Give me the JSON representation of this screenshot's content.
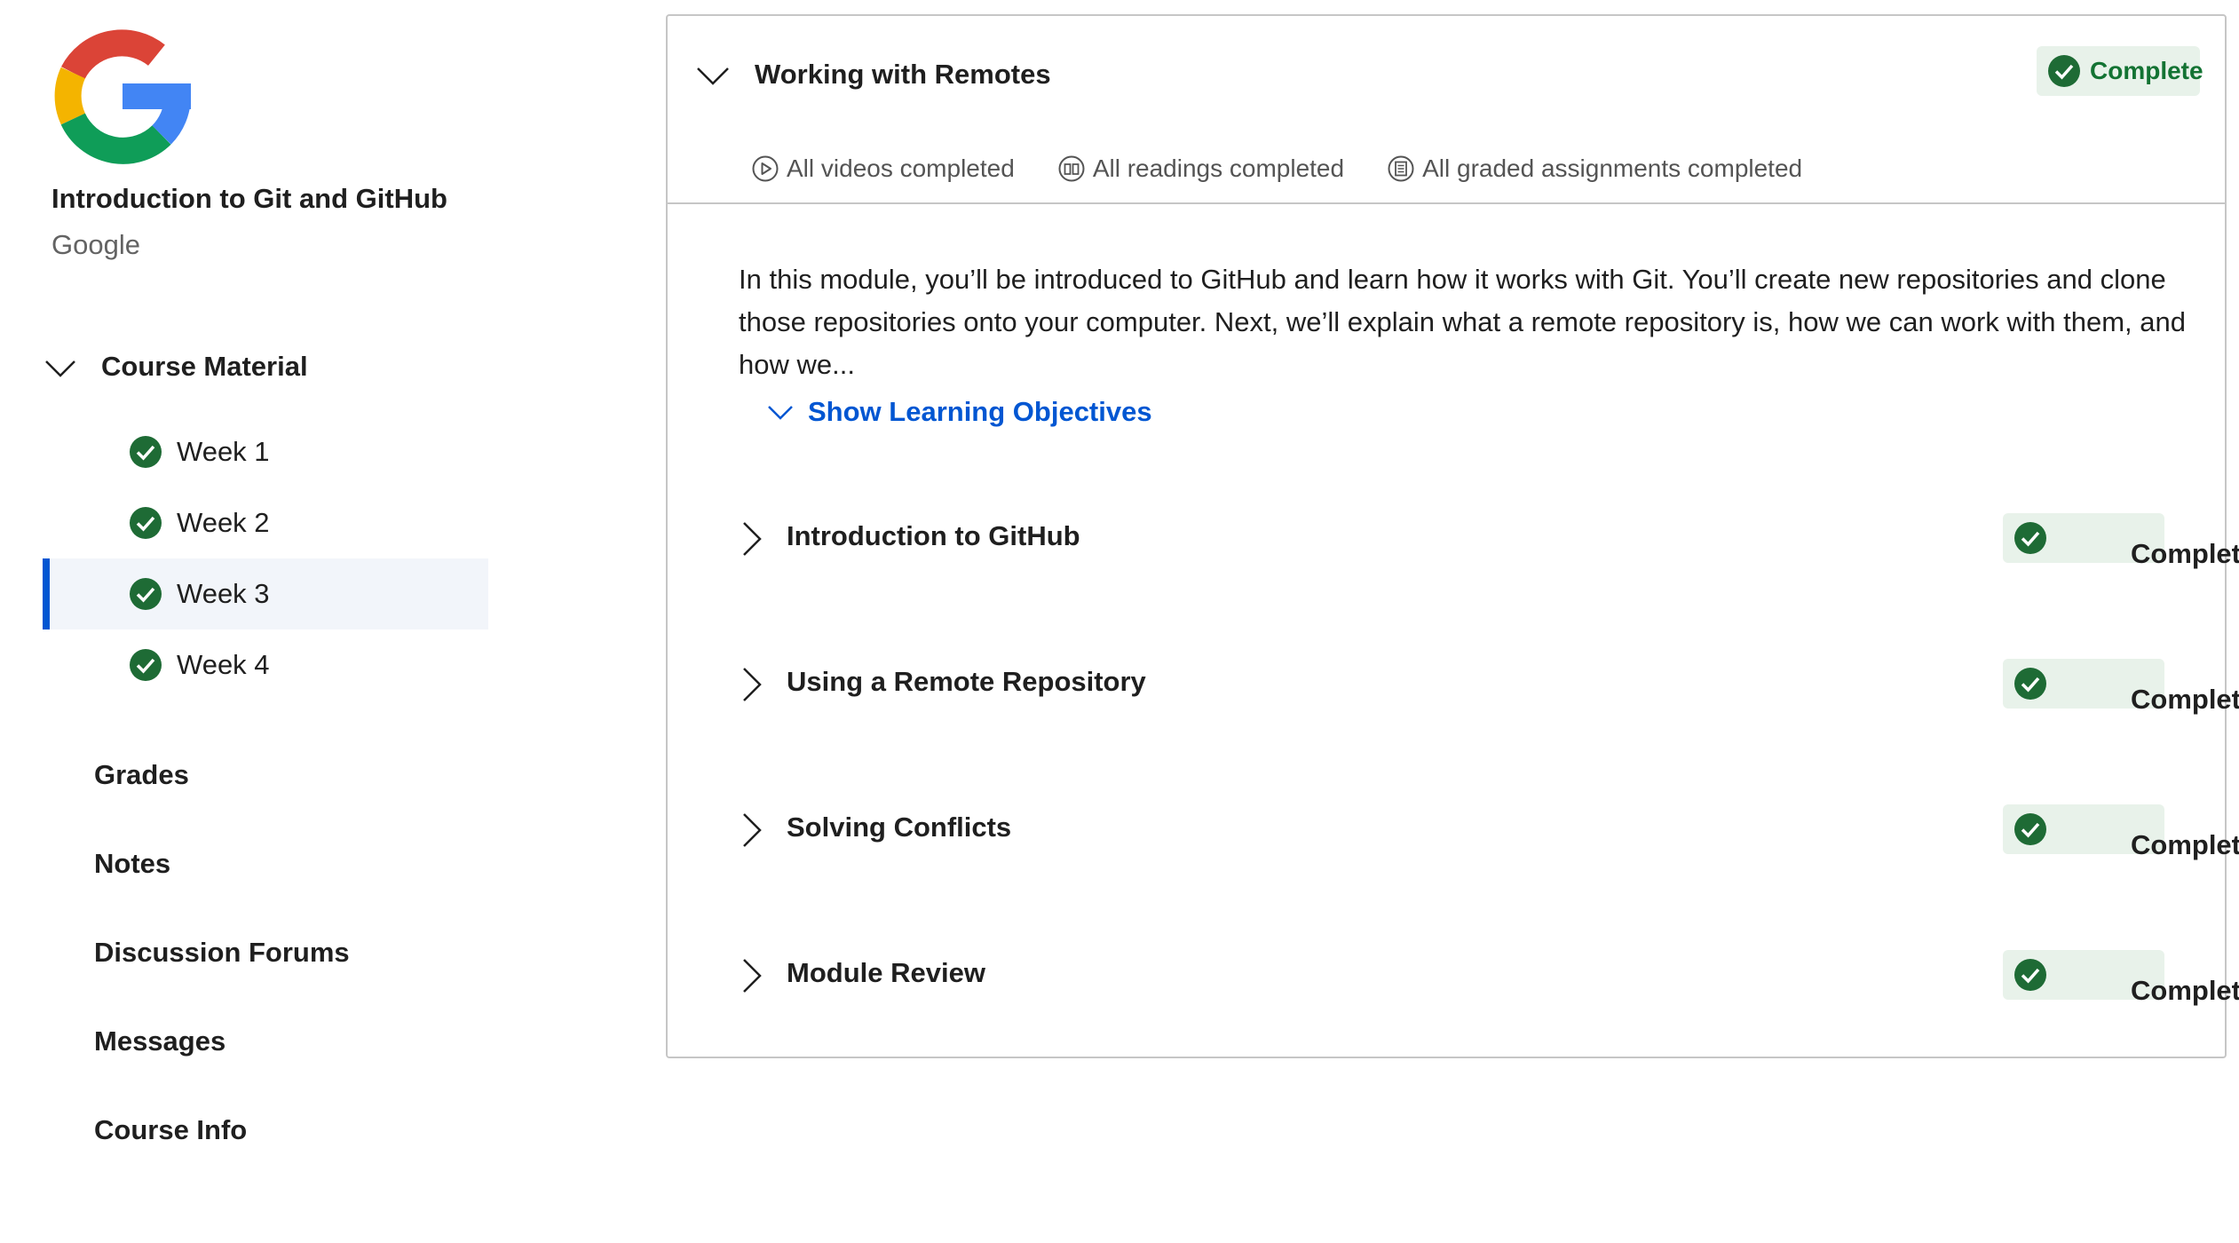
{
  "course": {
    "title": "Introduction to Git and GitHub",
    "partner": "Google",
    "logo_icon": "google-g-logo"
  },
  "sidebar": {
    "section_label": "Course Material",
    "weeks": [
      {
        "label": "Week 1",
        "status": "completed"
      },
      {
        "label": "Week 2",
        "status": "completed"
      },
      {
        "label": "Week 3",
        "status": "completed",
        "active": true
      },
      {
        "label": "Week 4",
        "status": "completed"
      }
    ],
    "links": [
      "Grades",
      "Notes",
      "Discussion Forums",
      "Messages",
      "Course Info"
    ]
  },
  "module": {
    "title": "Working with Remotes",
    "status": "Complete",
    "summary": {
      "videos": "All videos completed",
      "readings": "All readings completed",
      "assignments": "All graded assignments completed"
    },
    "description": "In this module, you’ll be introduced to GitHub and learn how it works with Git. You’ll create new repositories and clone those repositories onto your computer. Next, we’ll explain what a remote repository is, how we can work with them, and how we...",
    "objectives_label": "Show Learning Objectives",
    "lessons": [
      {
        "title": "Introduction to GitHub",
        "status": "Complete"
      },
      {
        "title": "Using a Remote Repository",
        "status": "Complete"
      },
      {
        "title": "Solving Conflicts",
        "status": "Complete"
      },
      {
        "title": "Module Review",
        "status": "Complete"
      }
    ]
  },
  "colors": {
    "accent": "#0056d2",
    "complete_green": "#137333",
    "complete_check": "#1e6b35",
    "badge_bg": "#e8f2ea",
    "border": "#c6c6c6"
  }
}
